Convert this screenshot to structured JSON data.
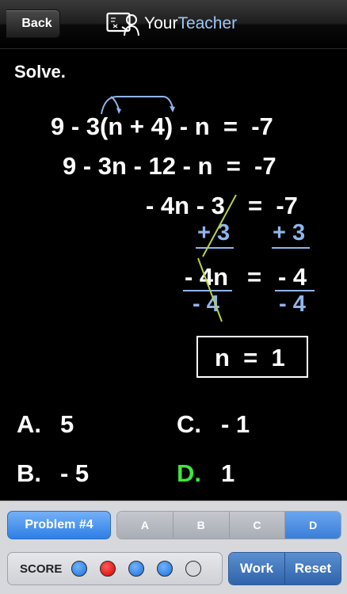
{
  "header": {
    "back_label": "Back",
    "logo_part1": "Your",
    "logo_part2": "Teacher"
  },
  "problem": {
    "instruction": "Solve.",
    "line1": "9 - 3(n + 4) - n  =  -7",
    "line2": "9 - 3n - 12 - n  =  -7",
    "line3_left": "- 4n - 3",
    "line3_right": "=  -7",
    "add_left": "+ 3",
    "add_right": "+ 3",
    "line4_left": "- 4n",
    "line4_eq": "=",
    "line4_right": "- 4",
    "div_left": "- 4",
    "div_right": "- 4",
    "answer": "n  =  1"
  },
  "choices": [
    {
      "letter": "A.",
      "value": "5"
    },
    {
      "letter": "B.",
      "value": "- 5"
    },
    {
      "letter": "C.",
      "value": "- 1"
    },
    {
      "letter": "D.",
      "value": "1"
    }
  ],
  "panel": {
    "problem_label": "Problem #4",
    "segments": [
      "A",
      "B",
      "C",
      "D"
    ],
    "selected_segment": "D",
    "score_label": "SCORE",
    "score_dots": [
      "blue",
      "red",
      "blue",
      "blue",
      "empty"
    ],
    "work_label": "Work",
    "reset_label": "Reset"
  },
  "colors": {
    "accent_blue": "#3a7ed9",
    "work_blue": "#8fb5ea",
    "correct_green": "#3ee63e",
    "wrong_red": "#d40000"
  }
}
